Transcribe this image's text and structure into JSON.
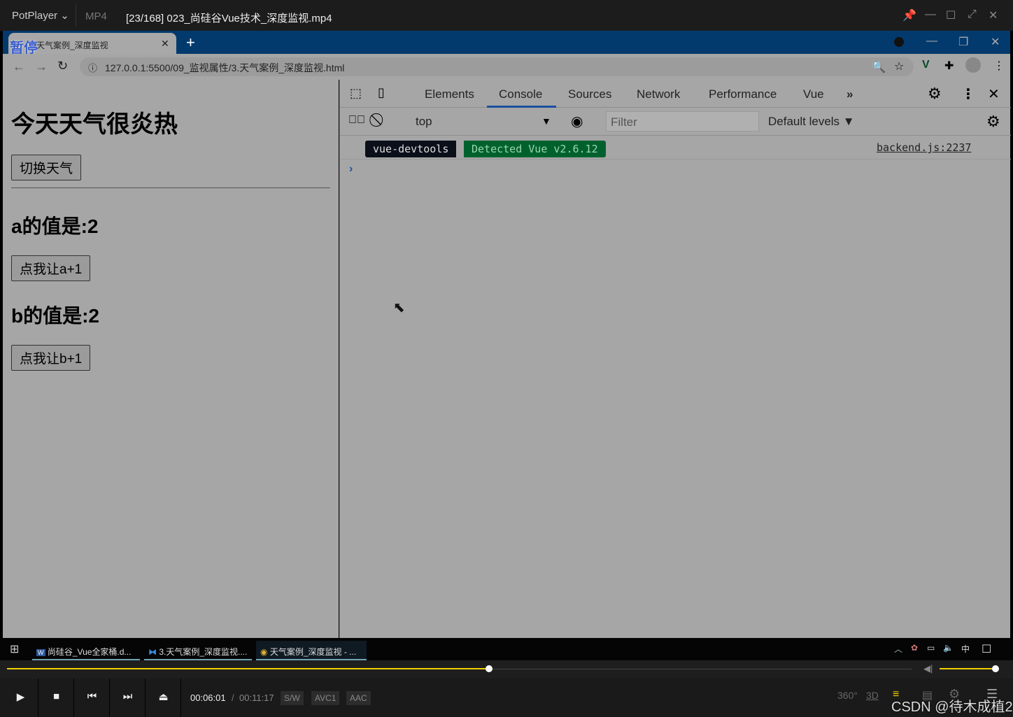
{
  "player": {
    "app": "PotPlayer",
    "format": "MP4",
    "title": "[23/168] 023_尚硅谷Vue技术_深度监视.mp4",
    "paused_label": "暂停",
    "time_current": "00:06:01",
    "time_sep": "/",
    "time_total": "00:11:17",
    "tags": [
      "S/W",
      "AVC1",
      "AAC"
    ],
    "progress_percent": 53.3,
    "volume_percent": 100,
    "watermark": "CSDN @待木成植2",
    "accent": "#f0d000"
  },
  "browser": {
    "tab_title": "天气案例_深度监视",
    "url": "127.0.0.1:5500/09_监视属性/3.天气案例_深度监视.html"
  },
  "page": {
    "heading": "今天天气很炎热",
    "toggle_button": "切换天气",
    "a_text": "a的值是:2",
    "a_button": "点我让a+1",
    "b_text": "b的值是:2",
    "b_button": "点我让b+1"
  },
  "devtools": {
    "tabs": [
      "Elements",
      "Console",
      "Sources",
      "Network",
      "Performance",
      "Vue"
    ],
    "active_tab": "Console",
    "context": "top",
    "filter_placeholder": "Filter",
    "levels": "Default levels ▼",
    "log": {
      "badge1": "vue-devtools",
      "badge2": "Detected Vue v2.6.12",
      "source": "backend.js:2237"
    }
  },
  "taskbar": {
    "items": [
      "尚硅谷_Vue全家桶.d...",
      "3.天气案例_深度监视....",
      "天气案例_深度监视 - ..."
    ],
    "ime": "中"
  }
}
